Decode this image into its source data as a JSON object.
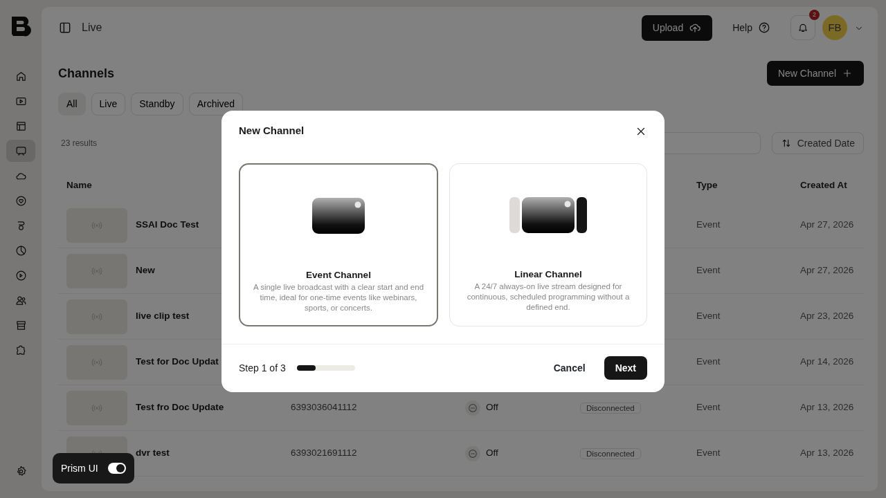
{
  "sidebar": {
    "items": [
      {
        "selected": false
      },
      {
        "selected": false
      },
      {
        "selected": false
      },
      {
        "selected": true
      },
      {
        "selected": false
      },
      {
        "selected": false
      },
      {
        "selected": false
      },
      {
        "selected": false
      },
      {
        "selected": false
      },
      {
        "selected": false
      },
      {
        "selected": false
      },
      {
        "selected": false
      }
    ]
  },
  "header": {
    "breadcrumb": "Live",
    "upload": "Upload",
    "help": "Help",
    "notifications": "2",
    "avatar": "FB"
  },
  "page": {
    "title": "Channels",
    "new_button": "New Channel",
    "filters": [
      {
        "label": "All",
        "selected": true
      },
      {
        "label": "Live",
        "selected": false
      },
      {
        "label": "Standby",
        "selected": false
      },
      {
        "label": "Archived",
        "selected": false
      }
    ],
    "results": "23 results",
    "sort": "Created Date"
  },
  "table": {
    "columns": [
      {
        "label": "Name"
      },
      {
        "label": "Type"
      },
      {
        "label": "Created At"
      }
    ],
    "rows": [
      {
        "name": "SSAI Doc Test",
        "type": "Event",
        "created": "Apr 27, 2026"
      },
      {
        "name": "New",
        "type": "Event",
        "created": "Apr 27, 2026"
      },
      {
        "name": "live clip test",
        "type": "Event",
        "created": "Apr 23, 2026"
      },
      {
        "name": "Test for Doc Updat",
        "type": "Event",
        "created": "Apr 14, 2026"
      },
      {
        "name": "Test fro Doc Update",
        "id": "6393036041112",
        "status": "Off",
        "connection": "Disconnected",
        "type": "Event",
        "created": "Apr 13, 2026"
      },
      {
        "name": "dvr test",
        "id": "6393021691112",
        "status": "Off",
        "connection": "Disconnected",
        "type": "Event",
        "created": "Apr 13, 2026"
      }
    ]
  },
  "prism_toggle": {
    "label": "Prism UI",
    "on": true
  },
  "modal": {
    "title": "New Channel",
    "options": [
      {
        "kind": "event",
        "title": "Event Channel",
        "description": "A single live broadcast with a clear start and end time, ideal for one-time events like webinars, sports, or concerts.",
        "selected": true
      },
      {
        "kind": "linear",
        "title": "Linear Channel",
        "description": "A 24/7 always-on live stream designed for continuous, scheduled programming without a defined end.",
        "selected": false
      }
    ],
    "step": "Step 1 of 3",
    "progress": {
      "level": 0.33
    },
    "cancel": "Cancel",
    "next": "Next"
  }
}
